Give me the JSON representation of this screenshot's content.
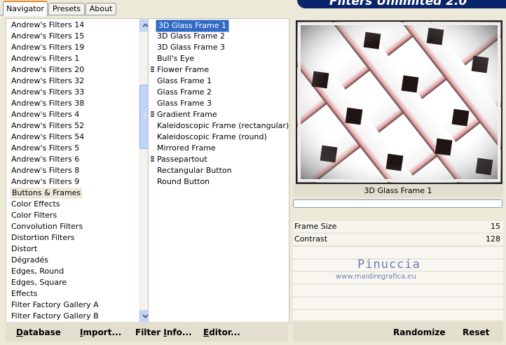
{
  "tabs": [
    {
      "label": "Navigator",
      "active": true
    },
    {
      "label": "Presets",
      "active": false
    },
    {
      "label": "About",
      "active": false
    }
  ],
  "banner": {
    "title": "Filters Unlimited 2.0"
  },
  "categories": [
    "Andrew's Filters 14",
    "Andrew's Filters 15",
    "Andrew's Filters 19",
    "Andrew's Filters 1",
    "Andrew's Filters 20",
    "Andrew's Filters 32",
    "Andrew's Filters 33",
    "Andrew's Filters 38",
    "Andrew's Filters 4",
    "Andrew's Filters 52",
    "Andrew's Filters 54",
    "Andrew's Filters 5",
    "Andrew's Filters 6",
    "Andrew's Filters 8",
    "Andrew's Filters 9",
    "Buttons & Frames",
    "Color Effects",
    "Color Filters",
    "Convolution Filters",
    "Distortion Filters",
    "Distort",
    "Dégradés",
    "Edges, Round",
    "Edges, Square",
    "Effects",
    "Filter Factory Gallery A",
    "Filter Factory Gallery B"
  ],
  "selected_category": "Buttons & Frames",
  "filters": [
    {
      "label": "3D Glass Frame 1",
      "selected": true,
      "marker": false
    },
    {
      "label": "3D Glass Frame 2",
      "selected": false,
      "marker": false
    },
    {
      "label": "3D Glass Frame 3",
      "selected": false,
      "marker": false
    },
    {
      "label": "Bull's Eye",
      "selected": false,
      "marker": false
    },
    {
      "label": "Flower Frame",
      "selected": false,
      "marker": true
    },
    {
      "label": "Glass Frame 1",
      "selected": false,
      "marker": false
    },
    {
      "label": "Glass Frame 2",
      "selected": false,
      "marker": false
    },
    {
      "label": "Glass Frame 3",
      "selected": false,
      "marker": false
    },
    {
      "label": "Gradient Frame",
      "selected": false,
      "marker": true
    },
    {
      "label": "Kaleidoscopic Frame (rectangular)",
      "selected": false,
      "marker": false
    },
    {
      "label": "Kaleidoscopic Frame (round)",
      "selected": false,
      "marker": false
    },
    {
      "label": "Mirrored Frame",
      "selected": false,
      "marker": false
    },
    {
      "label": "Passepartout",
      "selected": false,
      "marker": true
    },
    {
      "label": "Rectangular Button",
      "selected": false,
      "marker": false
    },
    {
      "label": "Round Button",
      "selected": false,
      "marker": false
    }
  ],
  "preview": {
    "filter_name": "3D Glass Frame 1"
  },
  "params": [
    {
      "label": "Frame Size",
      "value": "15"
    },
    {
      "label": "Contrast",
      "value": "128"
    }
  ],
  "watermark": {
    "line1": "Pinuccia",
    "line2": "www.maidiregrafica.eu"
  },
  "buttons": {
    "database": {
      "underline": "D",
      "rest": "atabase"
    },
    "import": {
      "underline": "I",
      "rest": "mport..."
    },
    "filter_info": {
      "pre": "Filter ",
      "underline": "I",
      "rest": "nfo..."
    },
    "editor": {
      "underline": "E",
      "rest": "ditor..."
    },
    "randomize": "Randomize",
    "reset": "Reset"
  }
}
